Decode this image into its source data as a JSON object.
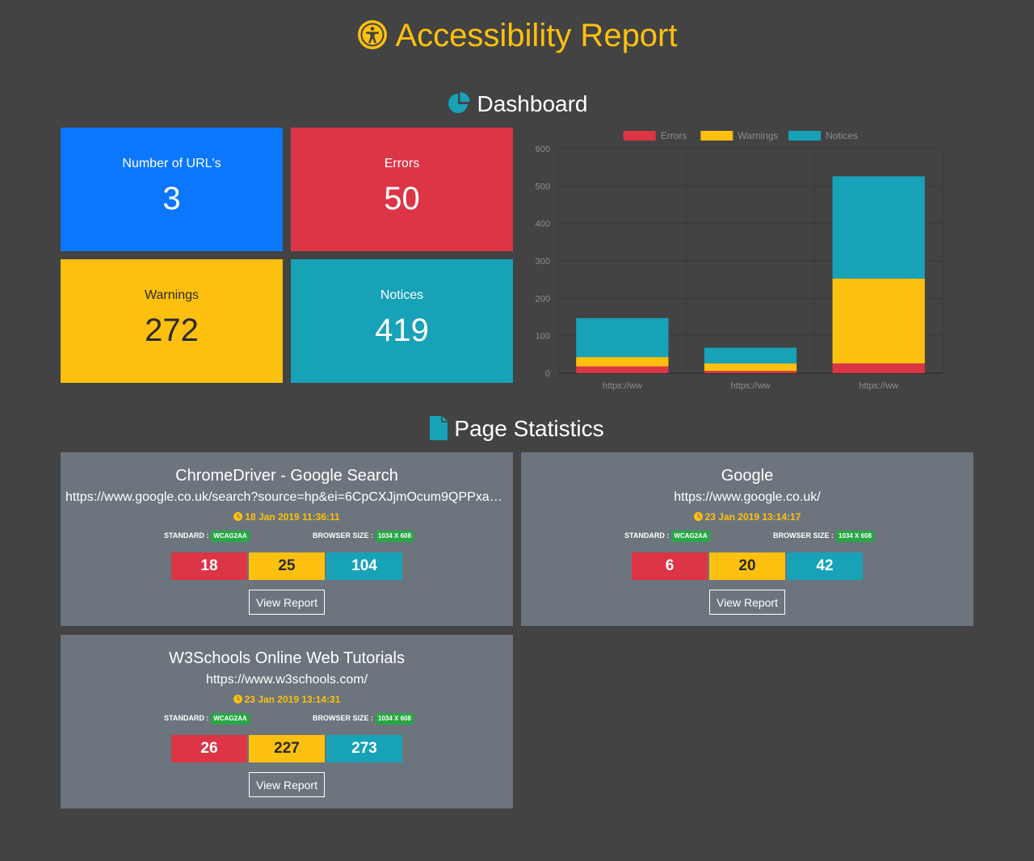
{
  "header": {
    "title": "Accessibility Report",
    "icon": "universal-access-icon",
    "accent": "#fdc00e"
  },
  "dashboard": {
    "heading": "Dashboard",
    "icon": "pie-chart-icon",
    "tiles": {
      "urls": {
        "label": "Number of URL's",
        "value": "3",
        "color": "#0b77fd"
      },
      "errors": {
        "label": "Errors",
        "value": "50",
        "color": "#dc3545"
      },
      "warnings": {
        "label": "Warnings",
        "value": "272",
        "color": "#fdc00e"
      },
      "notices": {
        "label": "Notices",
        "value": "419",
        "color": "#17a2b8"
      }
    }
  },
  "chart_data": {
    "type": "bar",
    "stacked": true,
    "categories": [
      "https://ww",
      "https://ww",
      "https://ww"
    ],
    "series": [
      {
        "name": "Errors",
        "values": [
          18,
          6,
          26
        ],
        "color": "#dc3545"
      },
      {
        "name": "Warnings",
        "values": [
          25,
          20,
          227
        ],
        "color": "#fdc00e"
      },
      {
        "name": "Notices",
        "values": [
          104,
          42,
          273
        ],
        "color": "#17a2b8"
      }
    ],
    "yticks": [
      0,
      100,
      200,
      300,
      400,
      500,
      600
    ],
    "ylim": [
      0,
      600
    ],
    "grid": true,
    "legend": "top"
  },
  "statistics": {
    "heading": "Page Statistics",
    "icon": "file-icon",
    "standard_label": "STANDARD :",
    "browser_label": "BROWSER SIZE :",
    "view_label": "View Report",
    "pages": [
      {
        "title": "ChromeDriver - Google Search",
        "url": "https://www.google.co.uk/search?source=hp&ei=6CpCXJjmOcum9QPPxaK…",
        "date": "18 Jan 2019 11:36:11",
        "standard": "WCAG2AA",
        "browser_size": "1034 X 608",
        "errors": "18",
        "warnings": "25",
        "notices": "104"
      },
      {
        "title": "Google",
        "url": "https://www.google.co.uk/",
        "date": "23 Jan 2019 13:14:17",
        "standard": "WCAG2AA",
        "browser_size": "1034 X 608",
        "errors": "6",
        "warnings": "20",
        "notices": "42"
      },
      {
        "title": "W3Schools Online Web Tutorials",
        "url": "https://www.w3schools.com/",
        "date": "23 Jan 2019 13:14:31",
        "standard": "WCAG2AA",
        "browser_size": "1034 X 608",
        "errors": "26",
        "warnings": "227",
        "notices": "273"
      }
    ]
  }
}
